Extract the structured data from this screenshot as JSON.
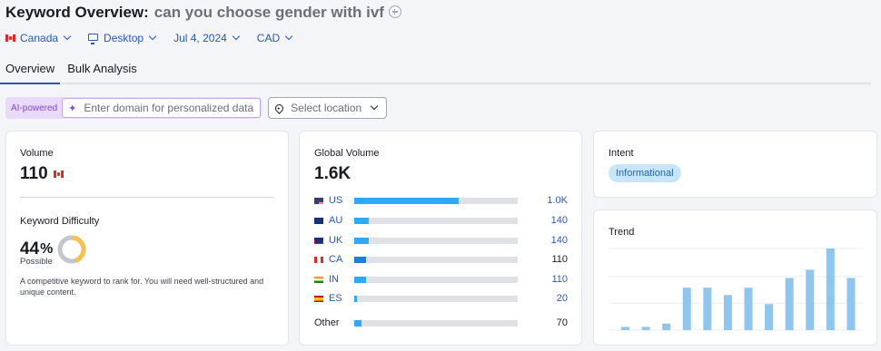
{
  "header": {
    "title": "Keyword Overview:",
    "keyword": "can you choose gender with ivf",
    "filters": {
      "country": "Canada",
      "device": "Desktop",
      "date": "Jul 4, 2024",
      "currency": "CAD"
    }
  },
  "tabs": [
    {
      "label": "Overview",
      "active": true
    },
    {
      "label": "Bulk Analysis",
      "active": false
    }
  ],
  "ai": {
    "badge": "AI-powered",
    "placeholder": "Enter domain for personalized data",
    "location_placeholder": "Select location"
  },
  "volume": {
    "label": "Volume",
    "value": "110",
    "kd_label": "Keyword Difficulty",
    "kd_value": "44",
    "kd_percent_sign": "%",
    "kd_fraction": 0.44,
    "kd_level": "Possible",
    "kd_description": "A competitive keyword to rank for. You will need well-structured and unique content."
  },
  "global_volume": {
    "label": "Global Volume",
    "value": "1.6K",
    "rows": [
      {
        "code": "US",
        "value": "1.0K",
        "share": 0.64,
        "link": true
      },
      {
        "code": "AU",
        "value": "140",
        "share": 0.09,
        "link": true
      },
      {
        "code": "UK",
        "value": "140",
        "share": 0.09,
        "link": true
      },
      {
        "code": "CA",
        "value": "110",
        "share": 0.07,
        "link": false
      },
      {
        "code": "IN",
        "value": "110",
        "share": 0.07,
        "link": true
      },
      {
        "code": "ES",
        "value": "20",
        "share": 0.015,
        "link": true
      },
      {
        "code": "Other",
        "value": "70",
        "share": 0.045,
        "link": false
      }
    ]
  },
  "intent": {
    "label": "Intent",
    "badge": "Informational"
  },
  "trend": {
    "label": "Trend",
    "values": [
      0.04,
      0.04,
      0.08,
      0.52,
      0.52,
      0.43,
      0.52,
      0.32,
      0.64,
      0.74,
      1.0,
      0.64
    ]
  },
  "colors": {
    "accent": "#2b57b4",
    "bar": "#2eaafc",
    "bar_ca": "#1f7fd8",
    "trend_bar": "#8fc6ef",
    "kd_ring": "#f7c14a",
    "ai_purple": "#8448d7"
  }
}
